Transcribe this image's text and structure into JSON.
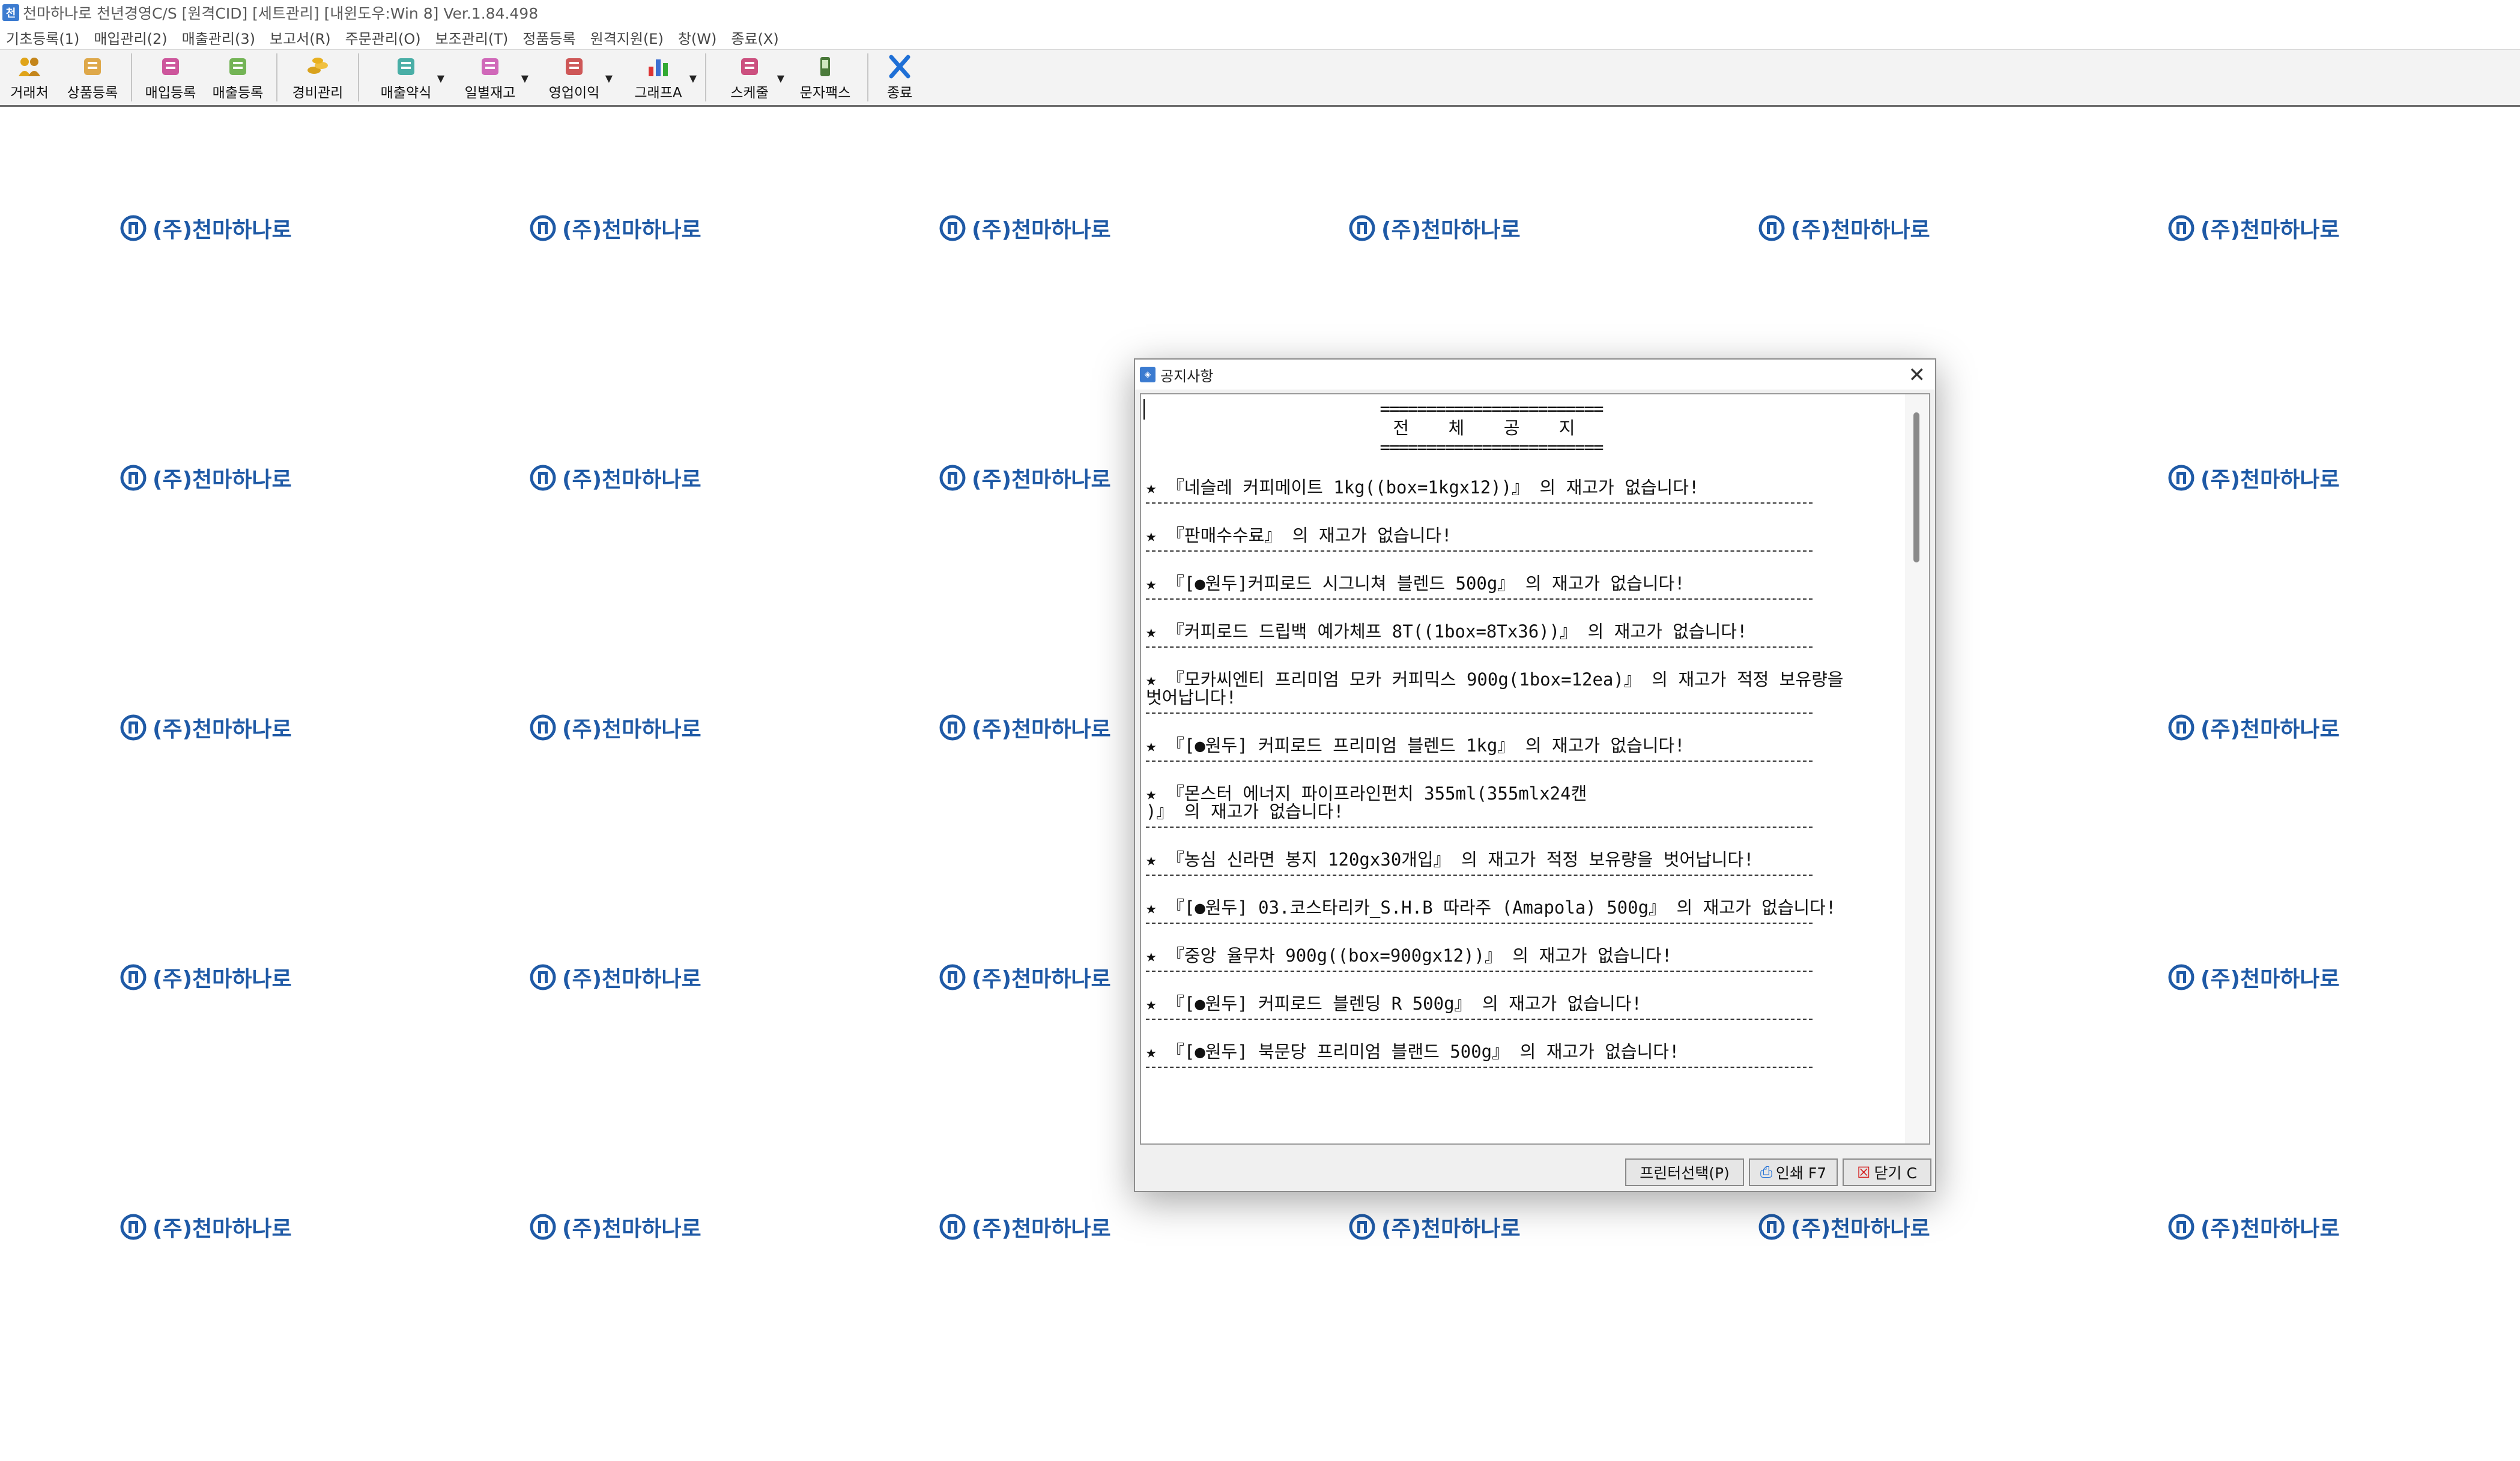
{
  "window": {
    "title": "천마하나로 천년경영C/S [원격CID] [세트관리] [내윈도우:Win 8] Ver.1.84.498",
    "app_icon": "app-icon"
  },
  "menu": [
    {
      "label": "기초등록(1)"
    },
    {
      "label": "매입관리(2)"
    },
    {
      "label": "매출관리(3)"
    },
    {
      "label": "보고서(R)"
    },
    {
      "label": "주문관리(O)"
    },
    {
      "label": "보조관리(T)"
    },
    {
      "label": "정품등록"
    },
    {
      "label": "원격지원(E)"
    },
    {
      "label": "창(W)"
    },
    {
      "label": "종료(X)"
    }
  ],
  "toolbar": [
    {
      "label": "거래처",
      "icon": "people-icon",
      "color": "#e0a419"
    },
    {
      "label": "상품등록",
      "icon": "goods-icon",
      "color": "#d99a2b"
    },
    {
      "label": "매입등록",
      "icon": "purchase-icon",
      "color": "#c53a8c"
    },
    {
      "label": "매출등록",
      "icon": "sales-icon",
      "color": "#5ca838"
    },
    {
      "label": "경비관리",
      "icon": "coins-icon",
      "color": "#d9a21c"
    },
    {
      "label": "매출약식",
      "icon": "quick-sales-icon",
      "color": "#2aa198"
    },
    {
      "label": "일별재고",
      "icon": "daily-stock-icon",
      "color": "#c94fae"
    },
    {
      "label": "영업이익",
      "icon": "profit-icon",
      "color": "#c73b3b"
    },
    {
      "label": "그래프A",
      "icon": "bar-graph-icon",
      "color": "#3c6fd1"
    },
    {
      "label": "스케줄",
      "icon": "schedule-icon",
      "color": "#c4336a"
    },
    {
      "label": "문자팩스",
      "icon": "phone-icon",
      "color": "#4a7a3a"
    },
    {
      "label": "종료",
      "icon": "exit-x-icon",
      "color": "#1e6fd6"
    }
  ],
  "watermark": {
    "text": "(주)천마하나로",
    "icon": "company-logo-icon",
    "color": "#1f5aa6"
  },
  "dialog": {
    "title": "공지사항",
    "header_rule": "========================",
    "header_title": "전 체 공 지",
    "items": [
      {
        "text": "★ 『네슬레 커피메이트 1kg((box=1kgx12))』 의 재고가 없습니다!"
      },
      {
        "text": "★ 『판매수수료』 의 재고가 없습니다!"
      },
      {
        "text": "★ 『[●원두]커피로드 시그니쳐 블렌드 500g』 의 재고가 없습니다!"
      },
      {
        "text": "★ 『커피로드 드립백 예가체프 8T((1box=8Tx36))』 의 재고가 없습니다!"
      },
      {
        "text": "★ 『모카씨엔티 프리미엄 모카 커피믹스 900g(1box=12ea)』 의 재고가 적정 보유량을\n벗어납니다!"
      },
      {
        "text": "★ 『[●원두] 커피로드 프리미엄 블렌드 1kg』 의 재고가 없습니다!"
      },
      {
        "text": "★ 『몬스터 에너지 파이프라인펀치 355ml(355mlx24캔\n)』 의 재고가 없습니다!"
      },
      {
        "text": "★ 『농심 신라면 봉지 120gx30개입』 의 재고가 적정 보유량을 벗어납니다!"
      },
      {
        "text": "★ 『[●원두] 03.코스타리카_S.H.B 따라주 (Amapola) 500g』 의 재고가 없습니다!"
      },
      {
        "text": "★ 『중앙 율무차 900g((box=900gx12))』 의 재고가 없습니다!"
      },
      {
        "text": "★ 『[●원두] 커피로드 블렌딩 R 500g』 의 재고가 없습니다!"
      },
      {
        "text": "★ 『[●원두] 북문당 프리미엄 블랜드 500g』 의 재고가 없습니다!"
      }
    ],
    "buttons": {
      "printer_select": "프린터선택(P)",
      "print": "인쇄 F7",
      "close": "닫기 C"
    }
  }
}
